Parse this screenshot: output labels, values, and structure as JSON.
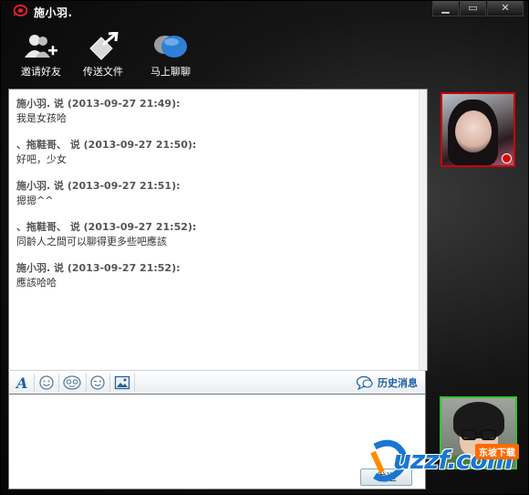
{
  "window": {
    "title": "施小羽.",
    "controls": {
      "minimize": "▁",
      "maximize": "▭",
      "close": "✕"
    }
  },
  "toolbar": {
    "items": [
      {
        "label": "邀请好友",
        "icon": "add-friend-icon"
      },
      {
        "label": "传送文件",
        "icon": "send-file-icon"
      },
      {
        "label": "马上聊聊",
        "icon": "chat-bubbles-icon"
      }
    ]
  },
  "messages": [
    {
      "header": "施小羽. 说 (2013-09-27 21:49):",
      "text": "我是女孩哈"
    },
    {
      "header": "、拖鞋哥、 说 (2013-09-27 21:50):",
      "text": "好吧，少女"
    },
    {
      "header": "施小羽. 说 (2013-09-27 21:51):",
      "text": "摁摁^^"
    },
    {
      "header": "、拖鞋哥、 说 (2013-09-27 21:52):",
      "text": "同齡人之間可以聊得更多些吧應該"
    },
    {
      "header": "施小羽. 说 (2013-09-27 21:52):",
      "text": "應該哈哈"
    }
  ],
  "format_bar": {
    "tools": [
      "font-icon",
      "emoji-icon",
      "animated-emoji-icon",
      "wink-icon",
      "image-icon"
    ],
    "history_label": "历史消息"
  },
  "input": {
    "send_label": "发送"
  },
  "watermark": {
    "text": "uzzf.com",
    "tag": "东坡下载"
  },
  "colors": {
    "accent_red": "#cc0000",
    "accent_green": "#31c431",
    "link_blue": "#1f5fa6"
  }
}
